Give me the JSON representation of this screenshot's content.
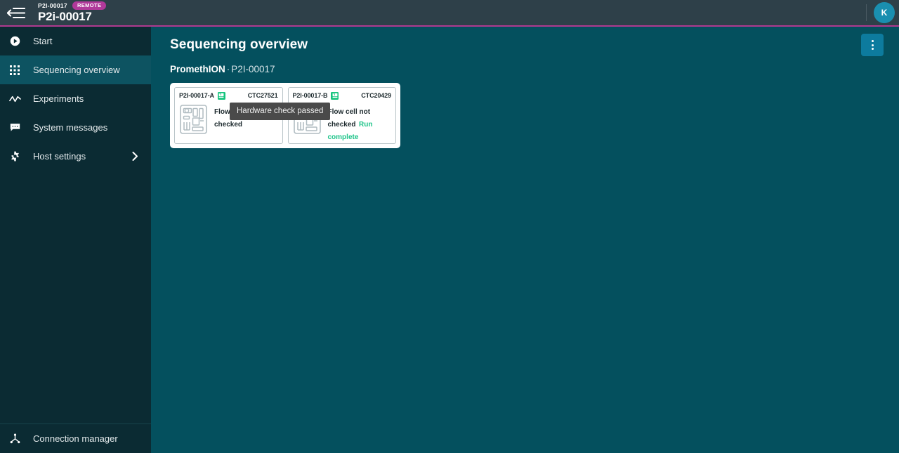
{
  "topbar": {
    "menu_icon": "collapse-menu-icon",
    "device_code": "P2I-00017",
    "remote_badge": "REMOTE",
    "device_name": "P2i-00017",
    "avatar_initial": "K"
  },
  "sidebar": {
    "items": [
      {
        "label": "Start",
        "icon": "play-circle-icon",
        "active": false
      },
      {
        "label": "Sequencing overview",
        "icon": "grid-icon",
        "active": true
      },
      {
        "label": "Experiments",
        "icon": "activity-line-icon",
        "active": false
      },
      {
        "label": "System messages",
        "icon": "message-icon",
        "active": false
      },
      {
        "label": "Host settings",
        "icon": "gear-icon",
        "active": false,
        "chevron": "chevron-right-icon"
      }
    ],
    "bottom": {
      "label": "Connection manager",
      "icon": "network-node-icon"
    }
  },
  "main": {
    "title": "Sequencing overview",
    "subtitle_device": "PromethION",
    "subtitle_separator": "·",
    "subtitle_id": "P2I-00017",
    "kebab_label": "More options",
    "flow_cells": [
      {
        "position": "P2I-00017-A",
        "flow_cell_id": "CTC27521",
        "status": "Flow cell not checked",
        "run_state": "",
        "badge": "hardware-check-passed-badge"
      },
      {
        "position": "P2I-00017-B",
        "flow_cell_id": "CTC20429",
        "status": "Flow cell not checked",
        "run_state": "Run complete",
        "badge": "hardware-check-passed-badge"
      }
    ],
    "tooltip": "Hardware check passed"
  },
  "colors": {
    "header_bg": "#2e4049",
    "header_accent": "#b03a8f",
    "sidebar_bg": "#0b2b33",
    "sidebar_active": "#0d5361",
    "main_bg": "#04505e",
    "badge_green": "#14c47d",
    "run_complete_green": "#1fc48a",
    "kebab_blue": "#0d7b9e",
    "remote_pill": "#b0399a",
    "avatar_blue": "#1a8fb0",
    "tooltip_bg": "#4a4a4a"
  }
}
